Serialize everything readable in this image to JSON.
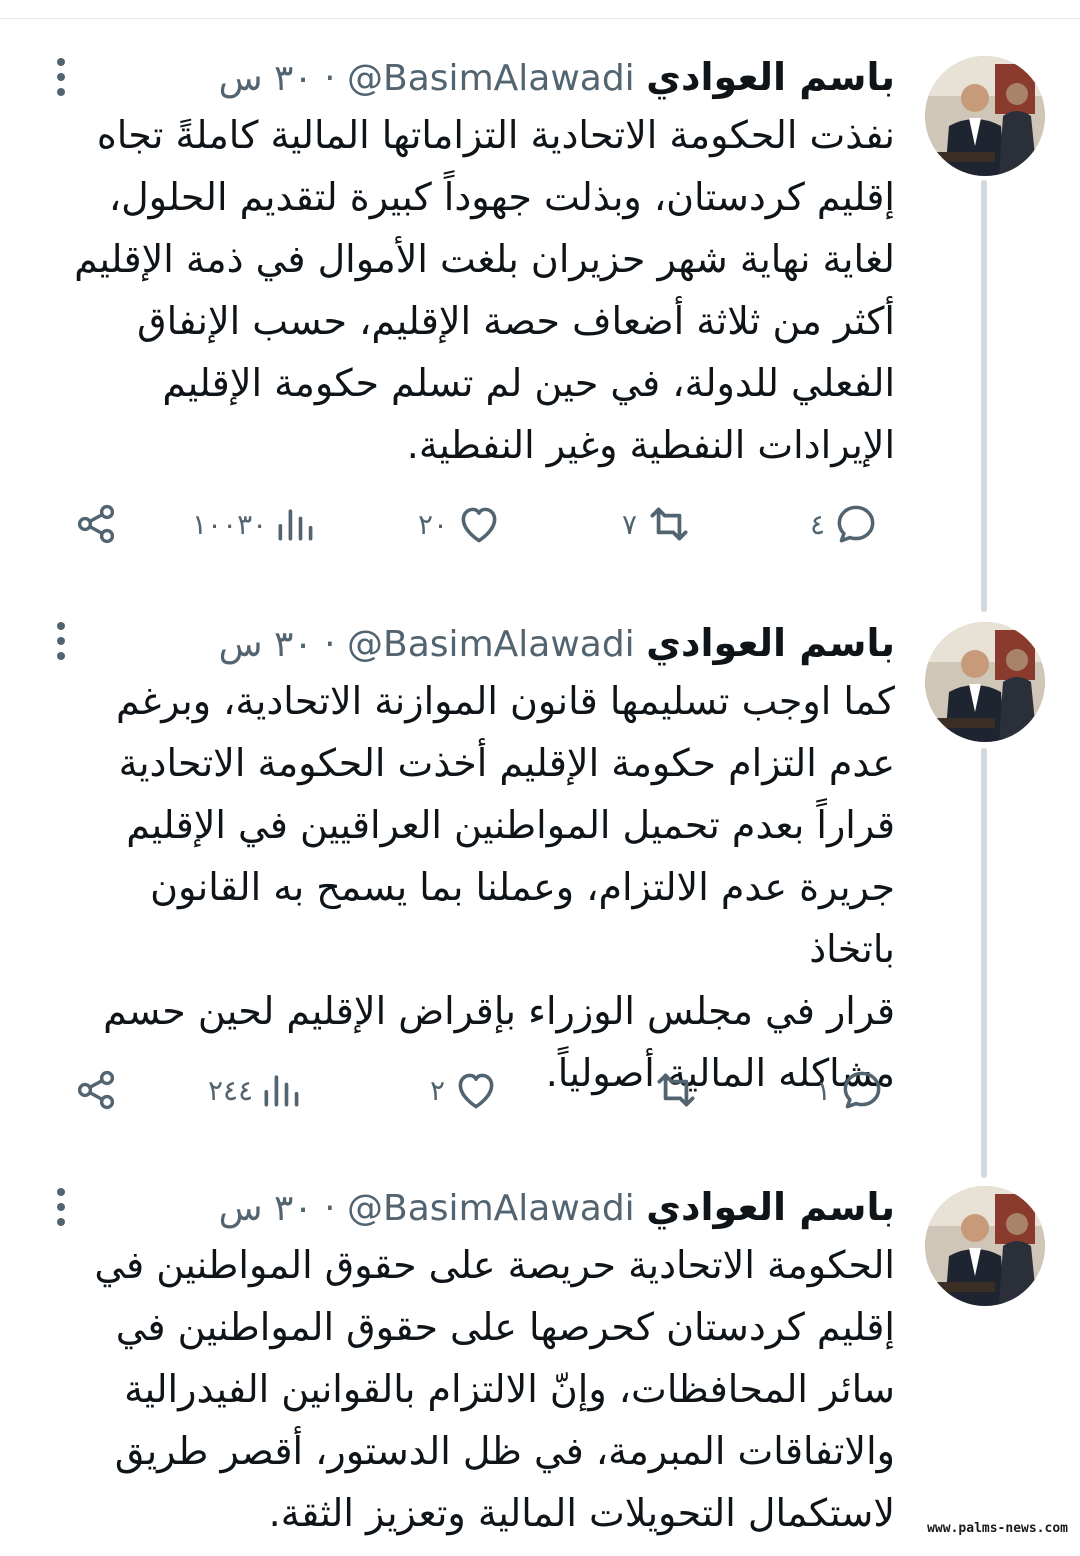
{
  "tweets": [
    {
      "author_name": "باسم العوادي",
      "handle": "@BasimAlawadi",
      "dot": "·",
      "time": "٣٠ س",
      "text": "نفذت الحكومة الاتحادية التزاماتها المالية كاملةً تجاه\nإقليم كردستان، وبذلت جهوداً كبيرة لتقديم الحلول،\nلغاية نهاية شهر حزيران بلغت الأموال في ذمة الإقليم\nأكثر من ثلاثة أضعاف حصة الإقليم، حسب الإنفاق\nالفعلي للدولة، في حين لم تسلم حكومة الإقليم\nالإيرادات النفطية وغير النفطية.",
      "replies": "٤",
      "retweets": "٧",
      "likes": "٢٠",
      "views": "١٠٠٣٠"
    },
    {
      "author_name": "باسم العوادي",
      "handle": "@BasimAlawadi",
      "dot": "·",
      "time": "٣٠ س",
      "text": "كما اوجب تسليمها قانون الموازنة الاتحادية، وبرغم\nعدم التزام حكومة الإقليم أخذت الحكومة الاتحادية\nقراراً بعدم تحميل المواطنين العراقيين في الإقليم\nجريرة عدم الالتزام، وعملنا بما يسمح به القانون باتخاذ\nقرار في مجلس الوزراء بإقراض الإقليم لحين حسم\nمشاكله المالية أصولياً.",
      "replies": "١",
      "retweets": "",
      "likes": "٢",
      "views": "٢٤٤"
    },
    {
      "author_name": "باسم العوادي",
      "handle": "@BasimAlawadi",
      "dot": "·",
      "time": "٣٠ س",
      "text": "الحكومة الاتحادية حريصة على حقوق المواطنين في\nإقليم كردستان كحرصها على حقوق المواطنين في\nسائر المحافظات، وإنّ الالتزام بالقوانين الفيدرالية\nوالاتفاقات المبرمة، في ظل الدستور، أقصر طريق\nلاستكمال التحويلات المالية وتعزيز الثقة.",
      "replies": "",
      "retweets": "",
      "likes": "",
      "views": ""
    }
  ],
  "icons": {
    "more": "more-vertical-icon",
    "reply": "reply-bubble-icon",
    "retweet": "retweet-icon",
    "like": "heart-icon",
    "views": "views-bar-chart-icon",
    "share": "share-icon"
  },
  "colors": {
    "text": "#0f1419",
    "secondary": "#536471",
    "thread_line": "#cfd9de"
  },
  "watermark": "www.palms-news.com"
}
